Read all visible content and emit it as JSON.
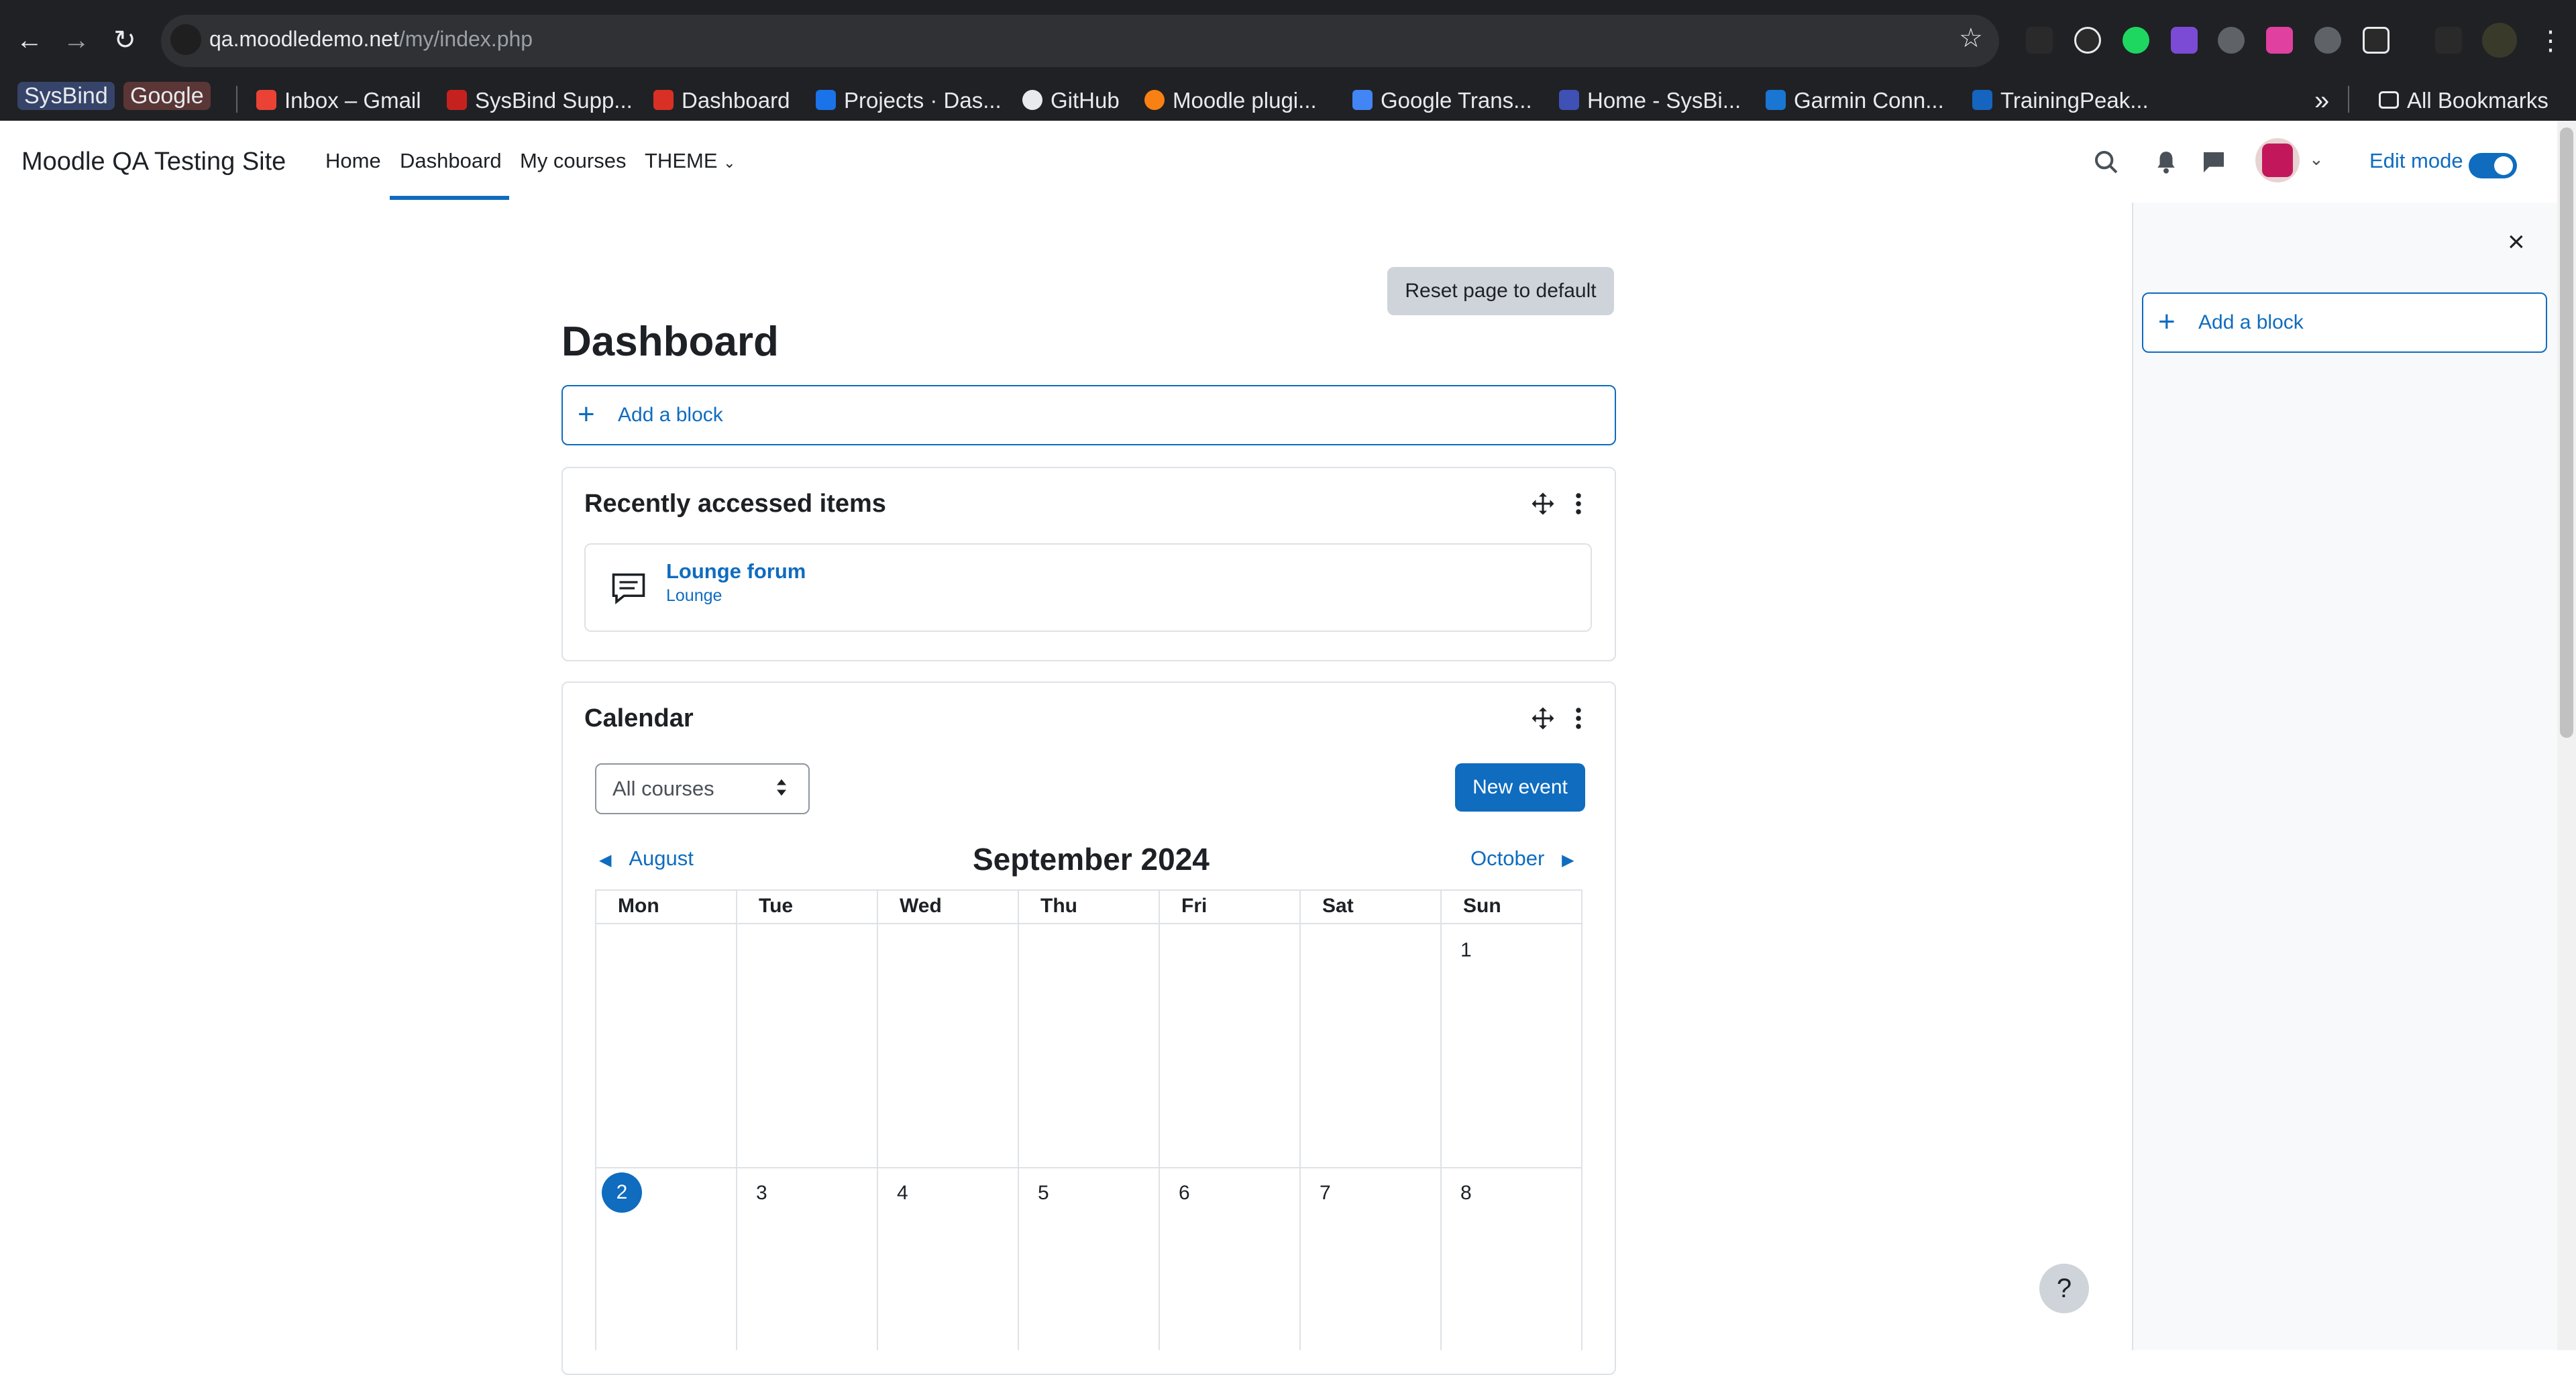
{
  "browser": {
    "url_host": "qa.moodledemo.net",
    "url_path": "/my/index.php",
    "bookmarks": [
      {
        "label": "SysBind",
        "chip": true
      },
      {
        "label": "Google",
        "chip": true
      },
      {
        "label": "Inbox – Gmail"
      },
      {
        "label": "SysBind Supp..."
      },
      {
        "label": "Dashboard"
      },
      {
        "label": "Projects · Das..."
      },
      {
        "label": "GitHub"
      },
      {
        "label": "Moodle plugi..."
      },
      {
        "label": "Google Trans..."
      },
      {
        "label": "Home - SysBi..."
      },
      {
        "label": "Garmin Conn..."
      },
      {
        "label": "TrainingPeak..."
      }
    ],
    "more_bookmarks": "»",
    "all_bookmarks": "All Bookmarks"
  },
  "navbar": {
    "site_name": "Moodle QA Testing Site",
    "links": [
      "Home",
      "Dashboard",
      "My courses",
      "THEME"
    ],
    "active": "Dashboard",
    "edit_mode_label": "Edit mode",
    "edit_mode_on": true
  },
  "page": {
    "reset_button": "Reset page to default",
    "title": "Dashboard",
    "add_block": "Add a block"
  },
  "recent": {
    "title": "Recently accessed items",
    "items": [
      {
        "name": "Lounge forum",
        "course": "Lounge",
        "icon": "forum-icon"
      }
    ]
  },
  "calendar": {
    "title": "Calendar",
    "course_filter": "All courses",
    "new_event": "New event",
    "prev_month": "August",
    "next_month": "October",
    "month": "September 2024",
    "days": [
      "Mon",
      "Tue",
      "Wed",
      "Thu",
      "Fri",
      "Sat",
      "Sun"
    ],
    "week1": [
      "",
      "",
      "",
      "",
      "",
      "",
      "1"
    ],
    "week2": [
      "2",
      "3",
      "4",
      "5",
      "6",
      "7",
      "8"
    ],
    "today": "2"
  },
  "drawer": {
    "add_block": "Add a block",
    "close": "×"
  },
  "help": "?"
}
